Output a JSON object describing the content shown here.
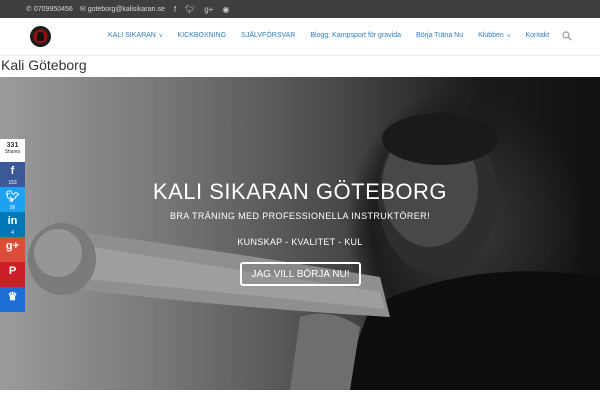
{
  "topbar": {
    "phone": "0709950456",
    "email": "goteborg@kalisikaran.se",
    "social_icons": [
      "facebook-icon",
      "twitter-icon",
      "google-plus-icon",
      "rss-icon"
    ]
  },
  "nav": {
    "items": [
      {
        "label": "KALI SIKARAN",
        "has_dropdown": true
      },
      {
        "label": "KICKBOXNING",
        "has_dropdown": false
      },
      {
        "label": "SJÄLVFÖRSVAR",
        "has_dropdown": false
      },
      {
        "label": "Blogg: Kampsport för gravida",
        "has_dropdown": false
      },
      {
        "label": "Börja Träna Nu",
        "has_dropdown": false
      },
      {
        "label": "Klubben",
        "has_dropdown": true
      },
      {
        "label": "Kontakt",
        "has_dropdown": false
      }
    ],
    "link_color": "#2f7ec4"
  },
  "page": {
    "title": "Kali Göteborg"
  },
  "hero": {
    "title": "KALI SIKARAN GÖTEBORG",
    "subtitle": "BRA TRÄNING MED PROFESSIONELLA INSTRUKTÖRER!",
    "motto": "KUNSKAP - KVALITET - KUL",
    "button_label": "JAG VILL BÖRJA NU!"
  },
  "share": {
    "total": "331",
    "total_label": "Shares",
    "facebook_count": "153",
    "twitter_count": "26",
    "linkedin_count": "4",
    "colors": {
      "facebook": "#3b5998",
      "twitter": "#1da1f2",
      "linkedin": "#0077b5",
      "google_plus": "#dd4b39",
      "pinterest": "#cb2027",
      "sumo": "#1d6fd8"
    }
  }
}
